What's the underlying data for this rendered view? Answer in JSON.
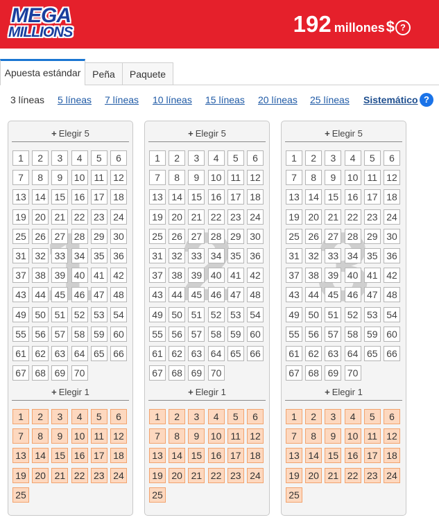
{
  "header": {
    "logo_line1": "MEGA",
    "logo_line2": "MILLIONS",
    "jackpot_amount": "192",
    "jackpot_unit": "millones",
    "currency": "$",
    "help_symbol": "?"
  },
  "tabs": [
    {
      "label": "Apuesta estándar",
      "active": true
    },
    {
      "label": "Peña",
      "active": false
    },
    {
      "label": "Paquete",
      "active": false
    }
  ],
  "line_options": {
    "current": "3 líneas",
    "links": [
      "5 líneas",
      "7 líneas",
      "10 líneas",
      "15 líneas",
      "20 líneas",
      "25 líneas"
    ],
    "system": "Sistemático",
    "help_symbol": "?"
  },
  "panels": [
    {
      "number": "1"
    },
    {
      "number": "2"
    },
    {
      "number": "3"
    }
  ],
  "main_section_label": "Elegir 5",
  "mega_section_label": "Elegir 1",
  "main_numbers_max": 70,
  "mega_numbers_max": 25,
  "colors": {
    "header_red": "#e5202b",
    "logo_blue": "#1a3f9e",
    "link_blue": "#1f5aa6",
    "tab_active_accent": "#1a76d2",
    "mega_ball_fill": "#fdd8bf",
    "mega_ball_border": "#f2a36e",
    "help_blue": "#1a73e8"
  },
  "icons": {
    "plus": "+",
    "help": "question-circle-icon"
  }
}
